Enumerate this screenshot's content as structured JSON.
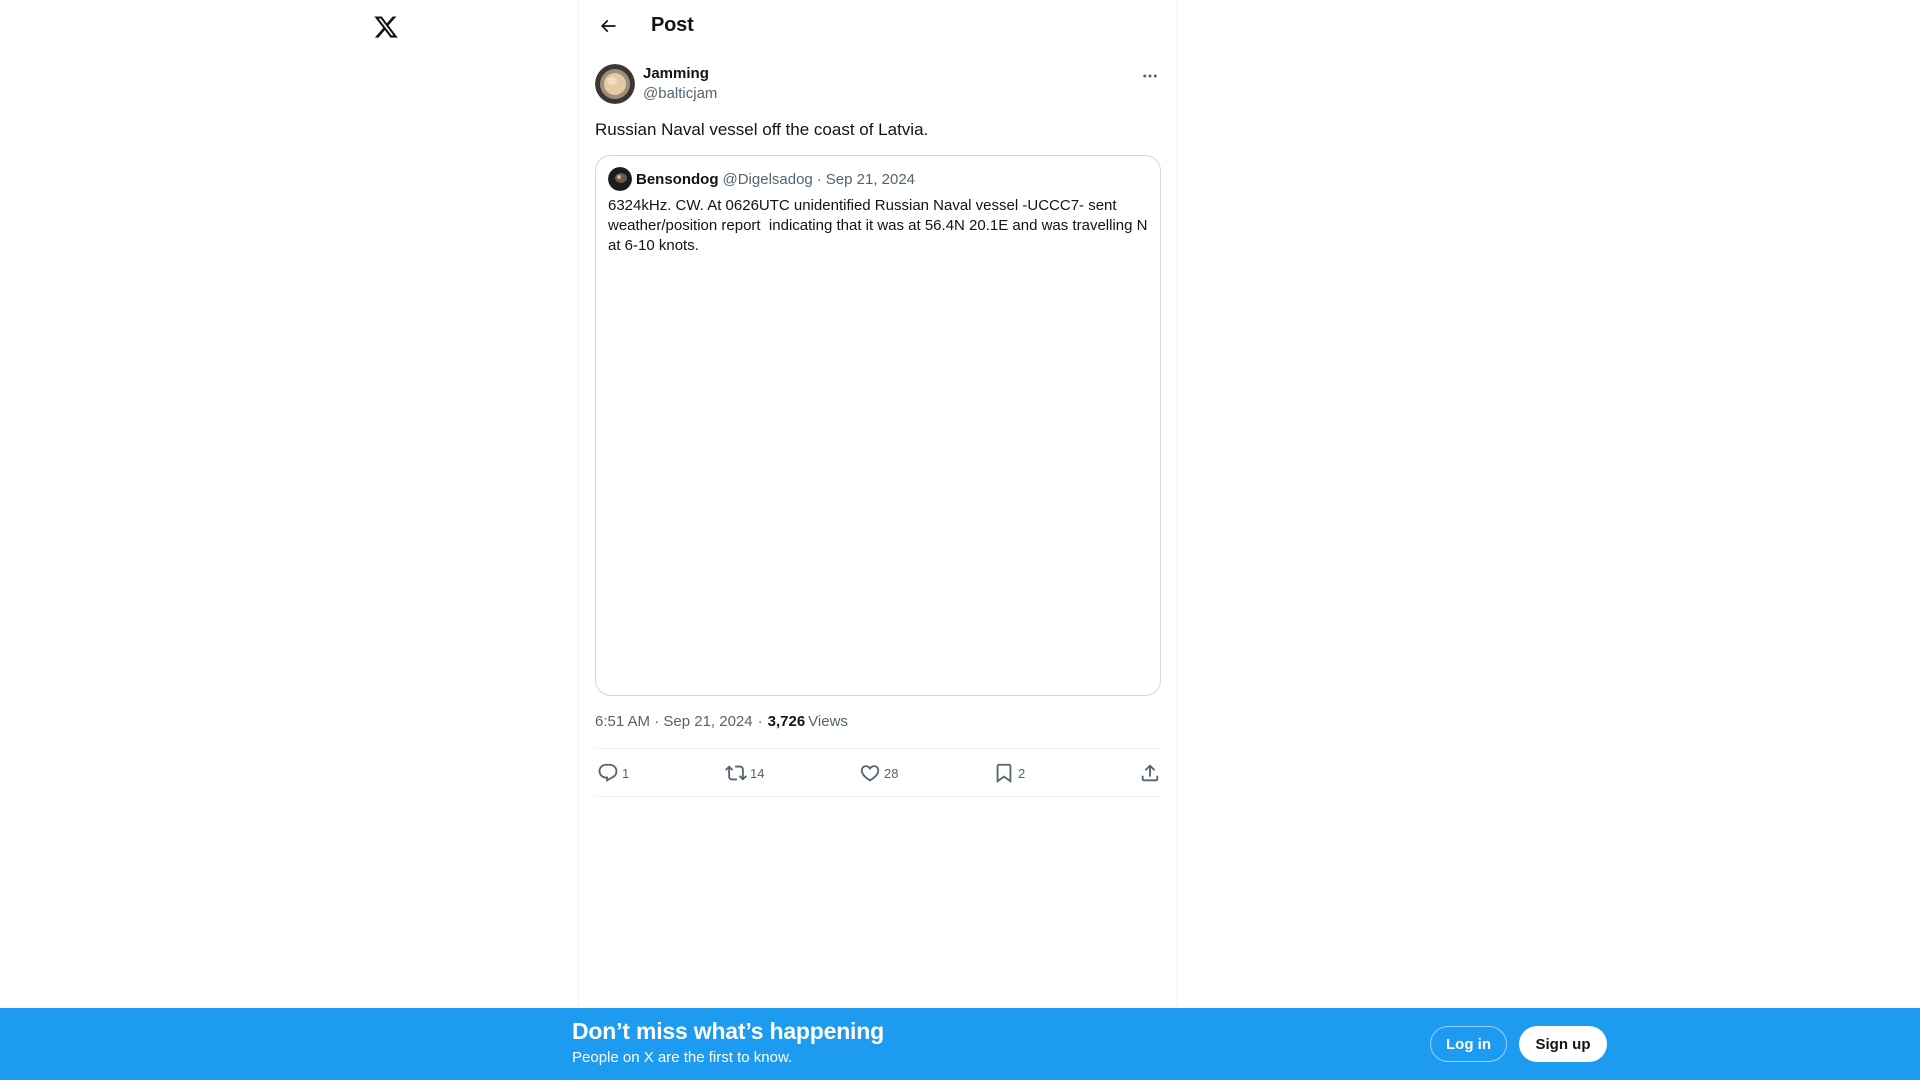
{
  "header": {
    "title": "Post"
  },
  "post": {
    "author_name": "Jamming",
    "author_handle": "@balticjam",
    "text": "Russian Naval vessel off the coast of Latvia.",
    "timestamp": "6:51 AM · Sep 21, 2024",
    "separator": "·",
    "views_count": "3,726",
    "views_label": "Views"
  },
  "quote": {
    "author_name": "Bensondog",
    "author_handle": "@Digelsadog",
    "dot": "·",
    "date": "Sep 21, 2024",
    "text": "6324kHz. CW. At 0626UTC unidentified Russian Naval vessel -UCCC7- sent weather/position report  indicating that it was at 56.4N 20.1E and was travelling N at 6-10 knots."
  },
  "actions": {
    "replies": "1",
    "reposts": "14",
    "likes": "28",
    "bookmarks": "2"
  },
  "bottom_bar": {
    "title": "Don’t miss what’s happening",
    "subtitle": "People on X are the first to know.",
    "login_label": "Log in",
    "signup_label": "Sign up"
  },
  "colors": {
    "accent": "#1d9bf0",
    "text_primary": "#0f1419",
    "text_secondary": "#536471",
    "border": "#cfd9de"
  },
  "icons": [
    "x-logo-icon",
    "back-arrow-icon",
    "more-icon",
    "reply-icon",
    "repost-icon",
    "like-icon",
    "bookmark-icon",
    "share-icon"
  ]
}
